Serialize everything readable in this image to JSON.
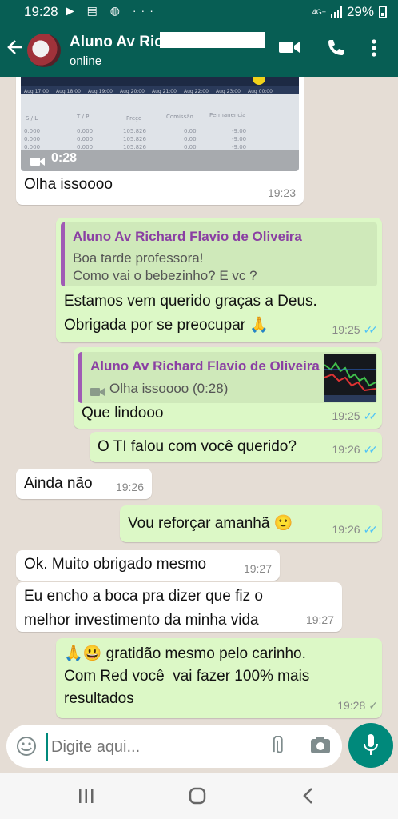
{
  "status_bar": {
    "time": "19:28",
    "notif_icons": "▶ ▤ ◍ ···",
    "network": "4G+",
    "battery": "29%"
  },
  "header": {
    "contact_name": "Aluno Av Ric",
    "status": "online"
  },
  "messages": [
    {
      "type": "in-video",
      "duration": "0:28",
      "text": "Olha issoooo",
      "time": "19:23"
    },
    {
      "type": "out-reply",
      "quote_author": "Aluno Av Richard Flavio de Oliveira",
      "quote_text": "Boa tarde professora!\nComo vai o bebezinho? E vc ?",
      "text": "Estamos vem querido graças a Deus.\nObrigada por se preocupar 🙏",
      "time": "19:25",
      "status": "read"
    },
    {
      "type": "out-reply",
      "quote_author": "Aluno Av Richard Flavio de Oliveira",
      "quote_text": "Olha issoooo (0:28)",
      "text": "Que lindooo",
      "time": "19:25",
      "status": "read"
    },
    {
      "type": "out",
      "text": "O TI falou com você querido?",
      "time": "19:26",
      "status": "read"
    },
    {
      "type": "in",
      "text": "Ainda não",
      "time": "19:26"
    },
    {
      "type": "out",
      "text": "Vou reforçar amanhã 🙂",
      "time": "19:26",
      "status": "read"
    },
    {
      "type": "in",
      "text": "Ok. Muito obrigado mesmo",
      "time": "19:27"
    },
    {
      "type": "in",
      "text": "Eu encho a boca pra dizer que fiz o\nmelhor investimento da minha vida",
      "time": "19:27"
    },
    {
      "type": "out",
      "text": "🙏😃 gratidão mesmo pelo carinho.\nCom Red você  vai fazer 100% mais\nresultados",
      "time": "19:28",
      "status": "delivered"
    }
  ],
  "input": {
    "placeholder": "Digite aqui..."
  },
  "colors": {
    "header": "#075e54",
    "outgoing": "#dcf8c6",
    "incoming": "#ffffff",
    "chat_bg": "#e5ddd5",
    "read_tick": "#4fc3f7",
    "mic": "#00897b"
  },
  "icons": [
    "back-arrow-icon",
    "video-call-icon",
    "phone-icon",
    "more-vert-icon",
    "video-icon",
    "emoji-icon",
    "attach-icon",
    "camera-icon",
    "mic-icon",
    "nav-recents-icon",
    "nav-home-icon",
    "nav-back-icon"
  ]
}
